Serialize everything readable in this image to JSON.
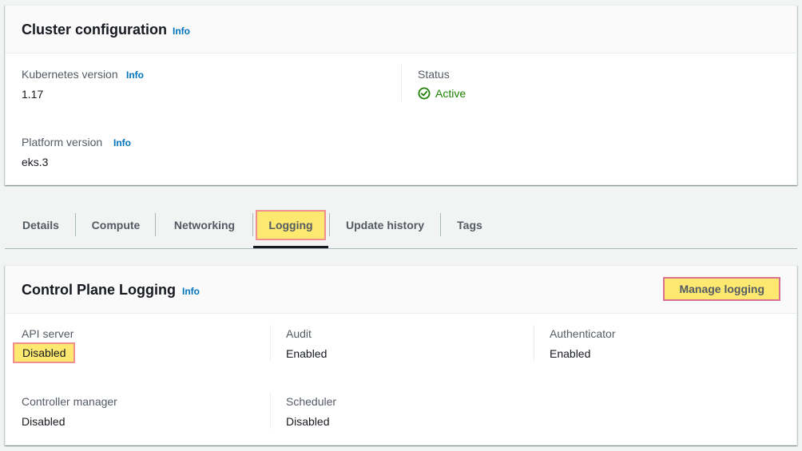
{
  "cluster_config": {
    "title": "Cluster configuration",
    "info": "Info",
    "kubernetes_version": {
      "label": "Kubernetes version",
      "info": "Info",
      "value": "1.17"
    },
    "status": {
      "label": "Status",
      "value": "Active",
      "color": "#1d8102"
    },
    "platform_version": {
      "label": "Platform version",
      "info": "Info",
      "value": "eks.3"
    }
  },
  "tabs": [
    {
      "label": "Details"
    },
    {
      "label": "Compute"
    },
    {
      "label": "Networking"
    },
    {
      "label": "Logging",
      "active": true
    },
    {
      "label": "Update history"
    },
    {
      "label": "Tags"
    }
  ],
  "control_plane_logging": {
    "title": "Control Plane Logging",
    "info": "Info",
    "manage_button": "Manage logging",
    "items": [
      {
        "label": "API server",
        "value": "Disabled"
      },
      {
        "label": "Audit",
        "value": "Enabled"
      },
      {
        "label": "Authenticator",
        "value": "Enabled"
      },
      {
        "label": "Controller manager",
        "value": "Disabled"
      },
      {
        "label": "Scheduler",
        "value": "Disabled"
      }
    ]
  },
  "colors": {
    "highlight": "#fde96f",
    "highlight_border": "#ef8f8f",
    "link": "#0073bb"
  }
}
